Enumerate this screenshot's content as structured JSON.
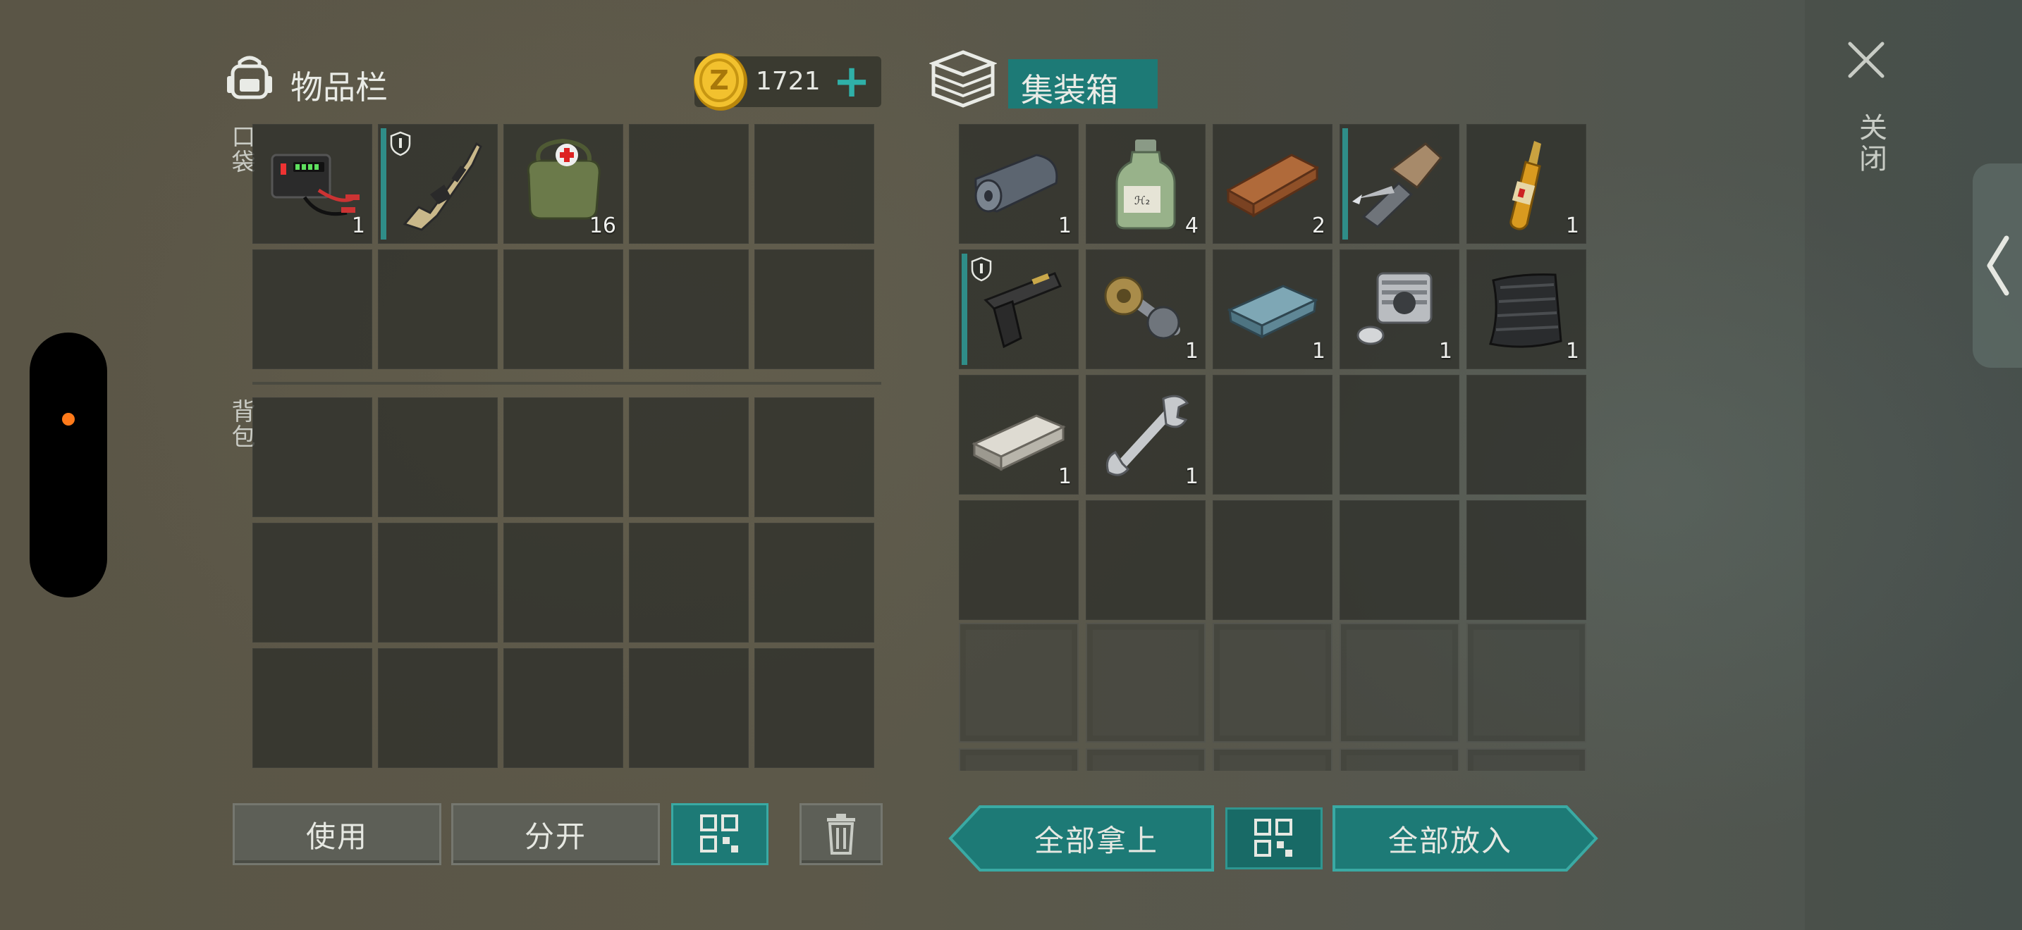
{
  "inventory": {
    "title": "物品栏",
    "pocket_label": "口袋",
    "backpack_label": "背包",
    "currency": {
      "amount": "1721",
      "coin_glyph": "Z",
      "add_label": "+"
    },
    "pocket_slots": [
      {
        "item": "battery-jumper-icon",
        "count": "1",
        "equipped": false
      },
      {
        "item": "assault-rifle-icon",
        "count": "",
        "equipped": true,
        "protected": true
      },
      {
        "item": "medkit-bag-icon",
        "count": "16",
        "equipped": false
      },
      {
        "item": "",
        "count": ""
      },
      {
        "item": "",
        "count": ""
      },
      {
        "item": "",
        "count": ""
      },
      {
        "item": "",
        "count": ""
      },
      {
        "item": "",
        "count": ""
      },
      {
        "item": "",
        "count": ""
      },
      {
        "item": "",
        "count": ""
      }
    ],
    "backpack_slot_count": 15,
    "buttons": {
      "use": "使用",
      "split": "分开"
    }
  },
  "container": {
    "title": "集装箱",
    "slots": [
      {
        "item": "fabric-roll-icon",
        "count": "1"
      },
      {
        "item": "chemical-bottle-icon",
        "count": "4"
      },
      {
        "item": "wood-plank-icon",
        "count": "2"
      },
      {
        "item": "harpoon-launcher-icon",
        "count": "",
        "equipped": true
      },
      {
        "item": "ampoule-icon",
        "count": "1"
      },
      {
        "item": "pistol-icon",
        "count": "",
        "equipped": true,
        "protected": true
      },
      {
        "item": "gear-shaft-icon",
        "count": "1"
      },
      {
        "item": "metal-ingot-icon",
        "count": "1"
      },
      {
        "item": "engine-cylinder-icon",
        "count": "1"
      },
      {
        "item": "carbon-fabric-icon",
        "count": "1"
      },
      {
        "item": "steel-bar-icon",
        "count": "1"
      },
      {
        "item": "wrench-icon",
        "count": "1"
      },
      {
        "item": "",
        "count": ""
      },
      {
        "item": "",
        "count": ""
      },
      {
        "item": "",
        "count": ""
      },
      {
        "item": "",
        "count": ""
      },
      {
        "item": "",
        "count": ""
      },
      {
        "item": "",
        "count": ""
      },
      {
        "item": "",
        "count": ""
      },
      {
        "item": "",
        "count": ""
      }
    ],
    "locked_slot_count": 10,
    "buttons": {
      "take_all": "全部拿上",
      "put_all": "全部放入"
    }
  },
  "close": {
    "label": "关闭"
  },
  "colors": {
    "accent": "#1d7a76",
    "accent_border": "#3aaaa4",
    "count_text": "#f0f1ee",
    "indicator": "#ff7a1a"
  }
}
